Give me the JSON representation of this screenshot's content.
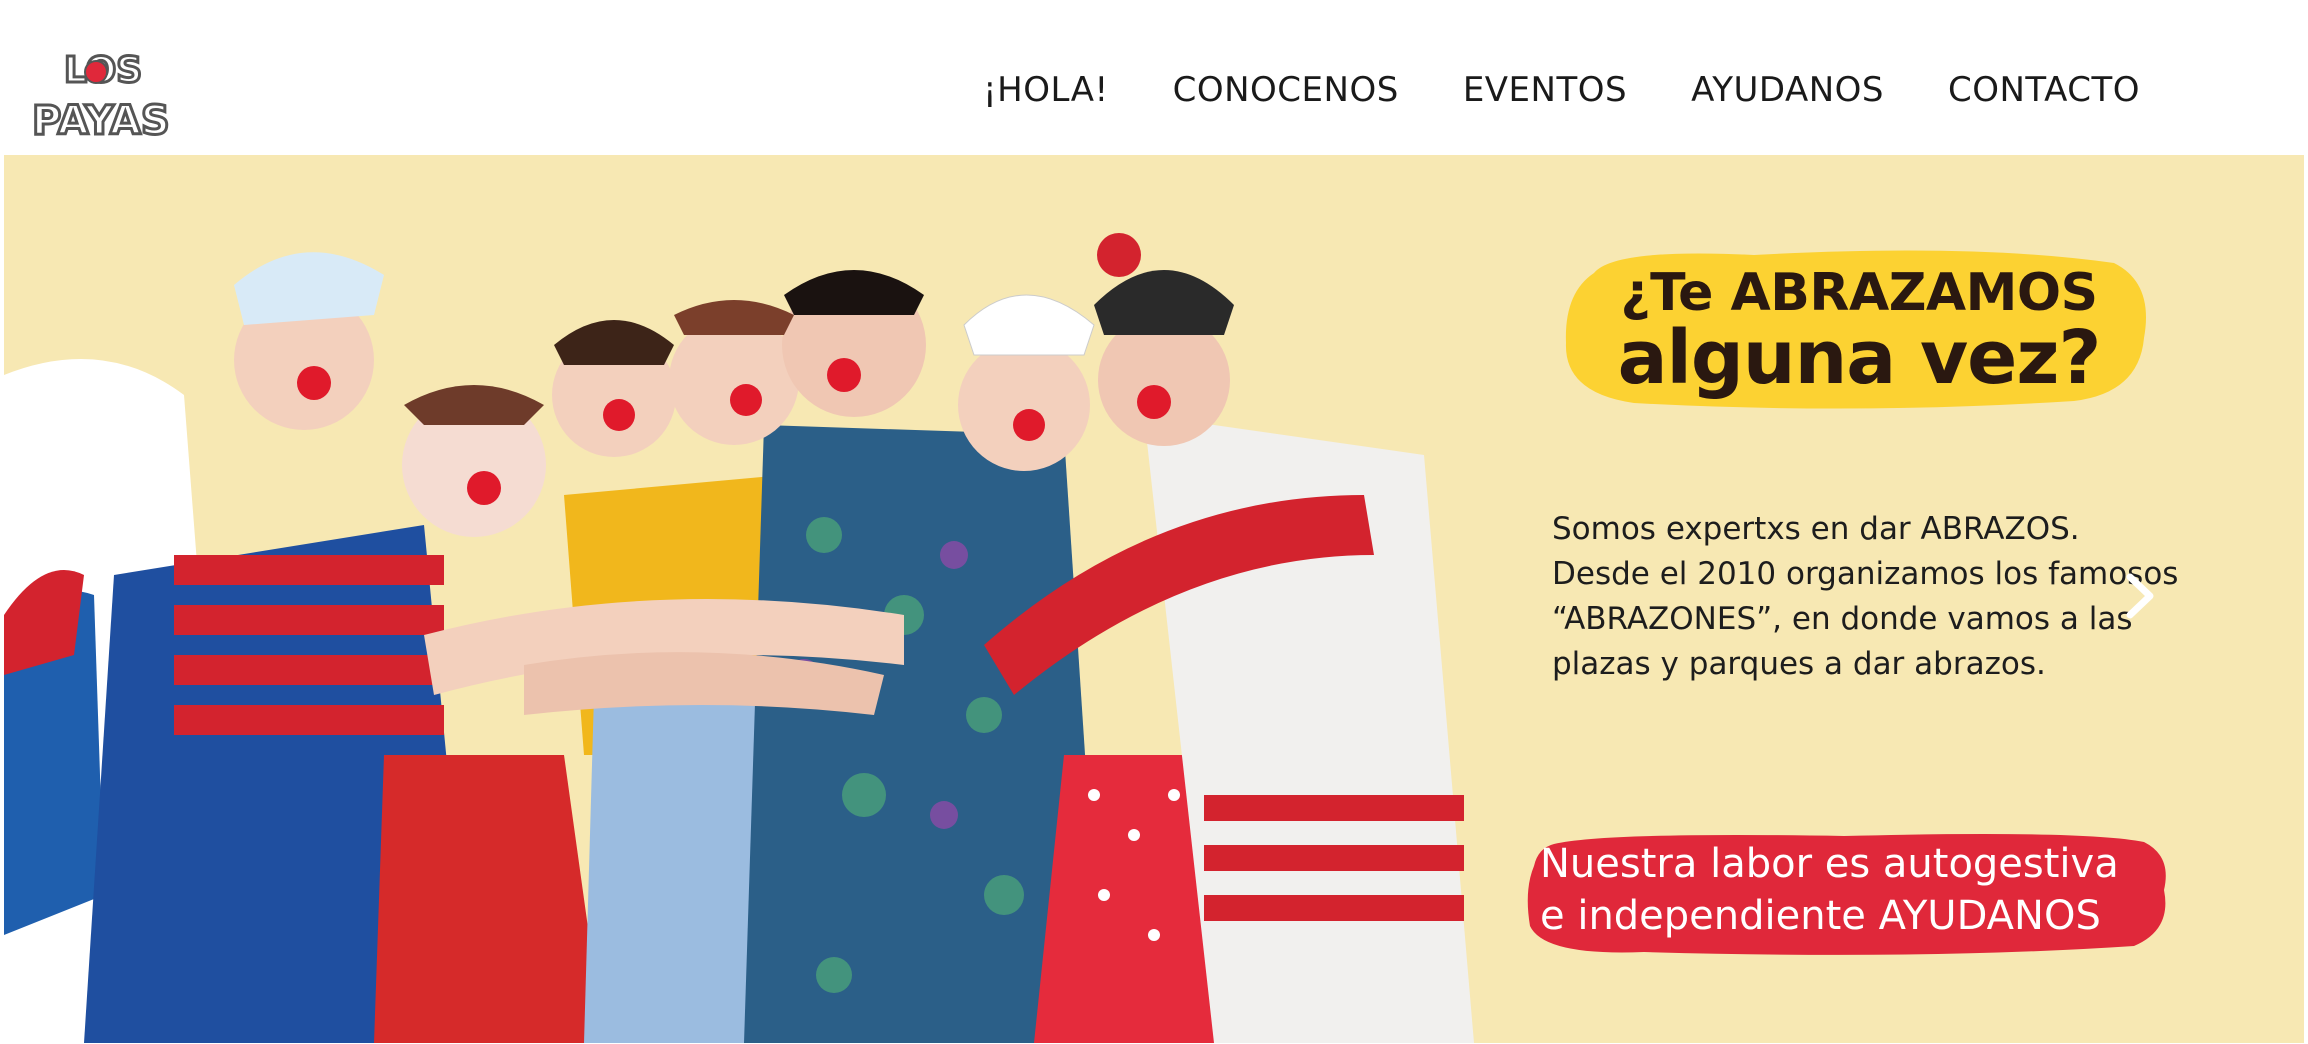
{
  "logo": {
    "text_line1": "LOS",
    "text_line2": "PAYAS"
  },
  "nav": {
    "items": [
      {
        "label": "¡HOLA!"
      },
      {
        "label": "CONOCENOS"
      },
      {
        "label": "EVENTOS"
      },
      {
        "label": "AYUDANOS"
      },
      {
        "label": "CONTACTO"
      }
    ]
  },
  "hero": {
    "tagline_line1": "¿Te ABRAZAMOS",
    "tagline_line2": "alguna vez?",
    "description_lines": [
      "Somos expertxs en  dar ABRAZOS.",
      "Desde el 2010 organizamos los famosos",
      "“ABRAZONES”, en donde vamos a las",
      "plazas y parques a dar abrazos."
    ],
    "cta_lines": [
      "Nuestra labor es autogestiva",
      "e independiente AYUDANOS"
    ],
    "next_icon": "chevron-right-icon"
  },
  "colors": {
    "hero_background": "#f7e8b3",
    "tagline_highlight": "#fcd232",
    "cta_background": "#e0283a",
    "text_dark": "#2a1810"
  }
}
